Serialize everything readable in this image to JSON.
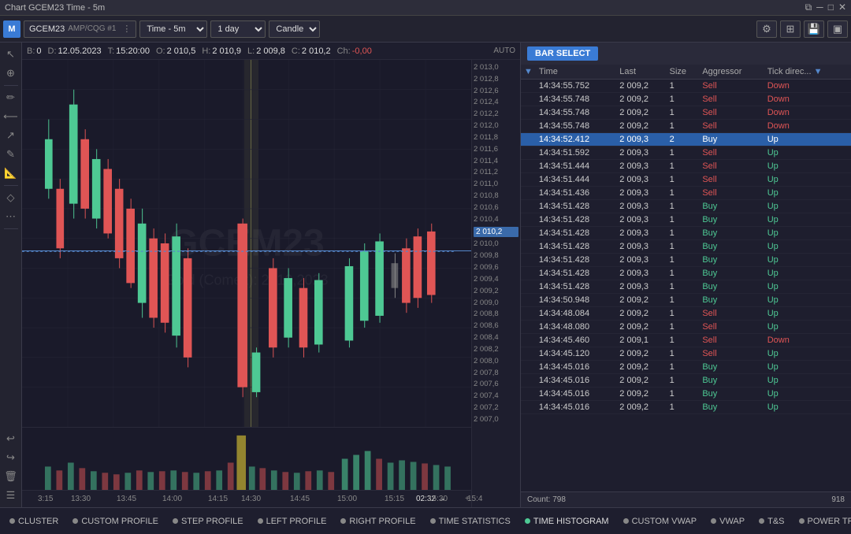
{
  "titlebar": {
    "title": "Chart GCEM23 Time - 5m",
    "controls": [
      "restore",
      "minimize",
      "maximize",
      "close"
    ]
  },
  "toolbar": {
    "logo": "M",
    "symbol": "GCEM23",
    "symbol_suffix": "AMP/CQG #1",
    "timeframe": "Time - 5m",
    "period": "1 day",
    "chart_type": "Candle",
    "icons": [
      "settings",
      "grid",
      "save",
      "panel"
    ]
  },
  "ohlc": {
    "b_label": "B:",
    "b_value": "0",
    "d_label": "D:",
    "d_value": "12.05.2023",
    "t_label": "T:",
    "t_value": "15:20:00",
    "o_label": "O:",
    "o_value": "2 010,5",
    "h_label": "H:",
    "h_value": "2 010,9",
    "l_label": "L:",
    "l_value": "2 009,8",
    "c_label": "C:",
    "c_value": "2 010,2",
    "ch_label": "Ch:",
    "ch_value": "-0,00",
    "auto": "AUTO"
  },
  "price_scale": {
    "levels": [
      "2 013,0",
      "2 012,8",
      "2 012,6",
      "2 012,4",
      "2 012,2",
      "2 012,0",
      "2 011,8",
      "2 011,6",
      "2 011,4",
      "2 011,2",
      "2 011,0",
      "2 010,8",
      "2 010,6",
      "2 010,4",
      "2 010,2",
      "2 010,0",
      "2 009,8",
      "2 009,6",
      "2 009,4",
      "2 009,2",
      "2 009,0",
      "2 008,8",
      "2 008,6",
      "2 008,4",
      "2 008,2",
      "2 008,0",
      "2 007,8",
      "2 007,6",
      "2 007,4",
      "2 007,2",
      "2 007,0"
    ],
    "current_price": "2 010,2"
  },
  "time_axis": {
    "labels": [
      "3:15",
      "13:30",
      "13:45",
      "14:00",
      "14:15",
      "14:30",
      "14:45",
      "15:00",
      "15:15",
      "15:30",
      "15:4"
    ],
    "timestamp": "02:32"
  },
  "watermark": {
    "symbol": "GCEM23",
    "subtitle": "Gold (Comex): 2010,2023"
  },
  "bar_select": {
    "label": "BAR SELECT"
  },
  "table": {
    "columns": [
      "Time",
      "Last",
      "Size",
      "Aggressor",
      "Tick direc..."
    ],
    "rows": [
      {
        "time": "14:34:55.752",
        "last": "2 009,2",
        "size": "1",
        "aggressor": "Sell",
        "tick": "Down",
        "highlight": false
      },
      {
        "time": "14:34:55.748",
        "last": "2 009,2",
        "size": "1",
        "aggressor": "Sell",
        "tick": "Down",
        "highlight": false
      },
      {
        "time": "14:34:55.748",
        "last": "2 009,2",
        "size": "1",
        "aggressor": "Sell",
        "tick": "Down",
        "highlight": false
      },
      {
        "time": "14:34:55.748",
        "last": "2 009,2",
        "size": "1",
        "aggressor": "Sell",
        "tick": "Down",
        "highlight": false
      },
      {
        "time": "14:34:52.412",
        "last": "2 009,3",
        "size": "2",
        "aggressor": "Buy",
        "tick": "Up",
        "highlight": true
      },
      {
        "time": "14:34:51.592",
        "last": "2 009,3",
        "size": "1",
        "aggressor": "Sell",
        "tick": "Up",
        "highlight": false
      },
      {
        "time": "14:34:51.444",
        "last": "2 009,3",
        "size": "1",
        "aggressor": "Sell",
        "tick": "Up",
        "highlight": false
      },
      {
        "time": "14:34:51.444",
        "last": "2 009,3",
        "size": "1",
        "aggressor": "Sell",
        "tick": "Up",
        "highlight": false
      },
      {
        "time": "14:34:51.436",
        "last": "2 009,3",
        "size": "1",
        "aggressor": "Sell",
        "tick": "Up",
        "highlight": false
      },
      {
        "time": "14:34:51.428",
        "last": "2 009,3",
        "size": "1",
        "aggressor": "Buy",
        "tick": "Up",
        "highlight": false
      },
      {
        "time": "14:34:51.428",
        "last": "2 009,3",
        "size": "1",
        "aggressor": "Buy",
        "tick": "Up",
        "highlight": false
      },
      {
        "time": "14:34:51.428",
        "last": "2 009,3",
        "size": "1",
        "aggressor": "Buy",
        "tick": "Up",
        "highlight": false
      },
      {
        "time": "14:34:51.428",
        "last": "2 009,3",
        "size": "1",
        "aggressor": "Buy",
        "tick": "Up",
        "highlight": false
      },
      {
        "time": "14:34:51.428",
        "last": "2 009,3",
        "size": "1",
        "aggressor": "Buy",
        "tick": "Up",
        "highlight": false
      },
      {
        "time": "14:34:51.428",
        "last": "2 009,3",
        "size": "1",
        "aggressor": "Buy",
        "tick": "Up",
        "highlight": false
      },
      {
        "time": "14:34:51.428",
        "last": "2 009,3",
        "size": "1",
        "aggressor": "Buy",
        "tick": "Up",
        "highlight": false
      },
      {
        "time": "14:34:50.948",
        "last": "2 009,2",
        "size": "1",
        "aggressor": "Buy",
        "tick": "Up",
        "highlight": false
      },
      {
        "time": "14:34:48.084",
        "last": "2 009,2",
        "size": "1",
        "aggressor": "Sell",
        "tick": "Up",
        "highlight": false
      },
      {
        "time": "14:34:48.080",
        "last": "2 009,2",
        "size": "1",
        "aggressor": "Sell",
        "tick": "Up",
        "highlight": false
      },
      {
        "time": "14:34:45.460",
        "last": "2 009,1",
        "size": "1",
        "aggressor": "Sell",
        "tick": "Down",
        "highlight": false
      },
      {
        "time": "14:34:45.120",
        "last": "2 009,2",
        "size": "1",
        "aggressor": "Sell",
        "tick": "Up",
        "highlight": false
      },
      {
        "time": "14:34:45.016",
        "last": "2 009,2",
        "size": "1",
        "aggressor": "Buy",
        "tick": "Up",
        "highlight": false
      },
      {
        "time": "14:34:45.016",
        "last": "2 009,2",
        "size": "1",
        "aggressor": "Buy",
        "tick": "Up",
        "highlight": false
      },
      {
        "time": "14:34:45.016",
        "last": "2 009,2",
        "size": "1",
        "aggressor": "Buy",
        "tick": "Up",
        "highlight": false
      },
      {
        "time": "14:34:45.016",
        "last": "2 009,2",
        "size": "1",
        "aggressor": "Buy",
        "tick": "Up",
        "highlight": false
      }
    ],
    "footer_count": "Count: 798",
    "footer_right": "918"
  },
  "bottom_toolbar": {
    "buttons": [
      {
        "label": "CLUSTER",
        "dot": "gray",
        "active": false
      },
      {
        "label": "CUSTOM PROFILE",
        "dot": "gray",
        "active": false
      },
      {
        "label": "STEP PROFILE",
        "dot": "gray",
        "active": false
      },
      {
        "label": "LEFT PROFILE",
        "dot": "gray",
        "active": false
      },
      {
        "label": "RIGHT PROFILE",
        "dot": "gray",
        "active": false
      },
      {
        "label": "TIME STATISTICS",
        "dot": "gray",
        "active": false
      },
      {
        "label": "TIME HISTOGRAM",
        "dot": "green",
        "active": true
      },
      {
        "label": "CUSTOM VWAP",
        "dot": "gray",
        "active": false
      },
      {
        "label": "VWAP",
        "dot": "gray",
        "active": false
      },
      {
        "label": "T&S",
        "dot": "gray",
        "active": false
      },
      {
        "label": "POWER TRADES",
        "dot": "gray",
        "active": false
      }
    ],
    "gear": "⚙"
  },
  "left_sidebar": {
    "tools": [
      "↖",
      "⊕",
      "✏",
      "⟵",
      "↗",
      "✎",
      "📐",
      "◇",
      "⋯"
    ]
  },
  "colors": {
    "buy": "#4ec994",
    "sell": "#e05555",
    "highlight_row": "#2a5fa8",
    "accent": "#3a7bd5"
  }
}
